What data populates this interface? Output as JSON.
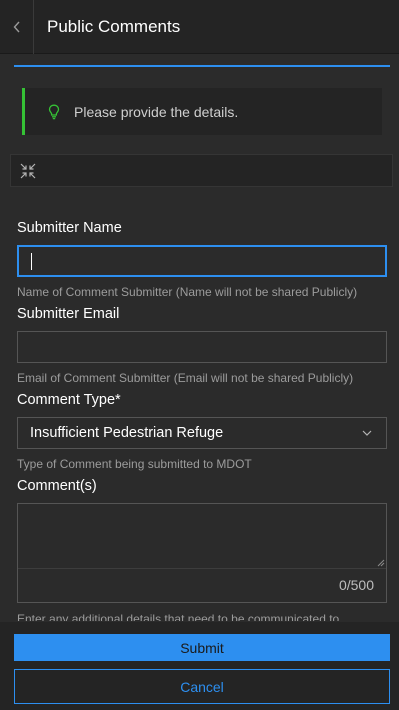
{
  "header": {
    "title": "Public Comments",
    "back_icon": "chevron-left-icon"
  },
  "notice": {
    "text": "Please provide the details.",
    "icon": "lightbulb-icon",
    "accent": "#35c235"
  },
  "toolbar": {
    "icon": "collapse-icon"
  },
  "form": {
    "name": {
      "label": "Submitter Name",
      "value": "",
      "hint": "Name of Comment Submitter (Name will not be shared Publicly)"
    },
    "email": {
      "label": "Submitter Email",
      "value": "",
      "hint": "Email of Comment Submitter (Email will not be shared Publicly)"
    },
    "type": {
      "label": "Comment Type*",
      "value": "Insufficient Pedestrian Refuge",
      "hint": "Type of Comment being submitted to MDOT"
    },
    "comments": {
      "label": "Comment(s)",
      "value": "",
      "counter": "0/500",
      "hint": "Enter any additional details that need to be communicated to"
    }
  },
  "footer": {
    "submit_label": "Submit",
    "cancel_label": "Cancel"
  },
  "colors": {
    "accent": "#2d8ff0",
    "background": "#2b2b2b",
    "panel": "#242424"
  }
}
